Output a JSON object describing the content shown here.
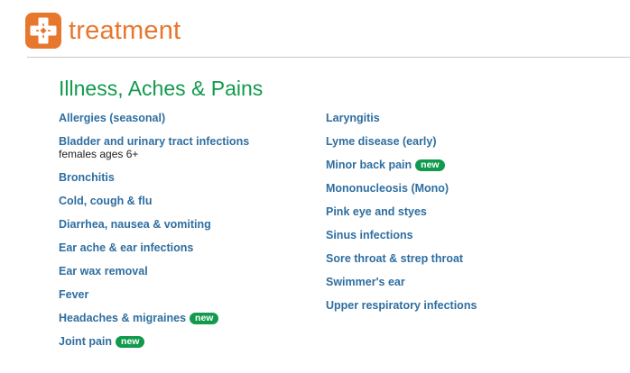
{
  "brand": {
    "name": "treatment",
    "logo_icon": "cross-icon",
    "color": "#e8772e"
  },
  "section": {
    "title": "Illness, Aches & Pains",
    "title_color": "#119a4d",
    "link_color": "#2e6ea0",
    "badge_color": "#119a4d"
  },
  "left_items": [
    {
      "label": "Allergies (seasonal)"
    },
    {
      "label": "Bladder and urinary tract infections",
      "sub": "females ages 6+"
    },
    {
      "label": "Bronchitis"
    },
    {
      "label": "Cold, cough & flu"
    },
    {
      "label": "Diarrhea, nausea & vomiting"
    },
    {
      "label": "Ear ache & ear infections"
    },
    {
      "label": "Ear wax removal"
    },
    {
      "label": "Fever"
    },
    {
      "label": "Headaches & migraines",
      "badge": "new"
    },
    {
      "label": "Joint pain",
      "badge": "new"
    }
  ],
  "right_items": [
    {
      "label": "Laryngitis"
    },
    {
      "label": "Lyme disease (early)"
    },
    {
      "label": "Minor back pain",
      "badge": "new"
    },
    {
      "label": "Mononucleosis (Mono)"
    },
    {
      "label": "Pink eye and styes"
    },
    {
      "label": "Sinus infections"
    },
    {
      "label": "Sore throat & strep throat"
    },
    {
      "label": "Swimmer's ear"
    },
    {
      "label": "Upper respiratory infections"
    }
  ]
}
